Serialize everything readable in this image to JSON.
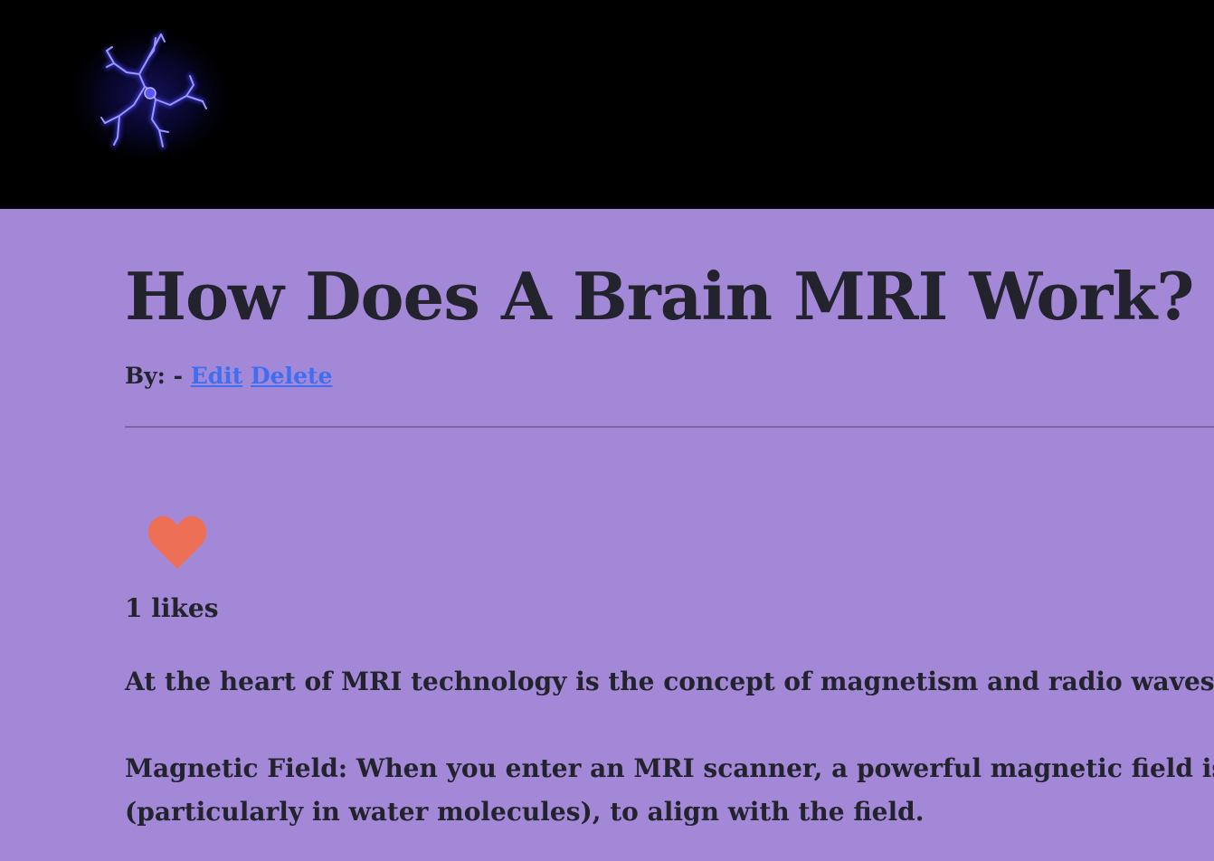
{
  "header": {
    "logo_icon": "neuron-logo-icon",
    "background": "#000000"
  },
  "post": {
    "title": "How Does A Brain MRI Work?",
    "byline_prefix": "By: -",
    "edit_label": "Edit",
    "delete_label": "Delete",
    "like_icon": "heart-icon",
    "likes_text": "1 likes",
    "paragraph_1": "At the heart of MRI technology is the concept of magnetism and radio waves. Here’s a s",
    "paragraph_2_line_1": "Magnetic Field: When you enter an MRI scanner, a powerful magnetic field is created a",
    "paragraph_2_line_2": "(particularly in water molecules), to align with the field."
  },
  "colors": {
    "page_background": "#a388d8",
    "text": "#23232e",
    "link": "#3f6ff0",
    "heart": "#ec6f56",
    "logo_glow": "#4b46ff"
  }
}
